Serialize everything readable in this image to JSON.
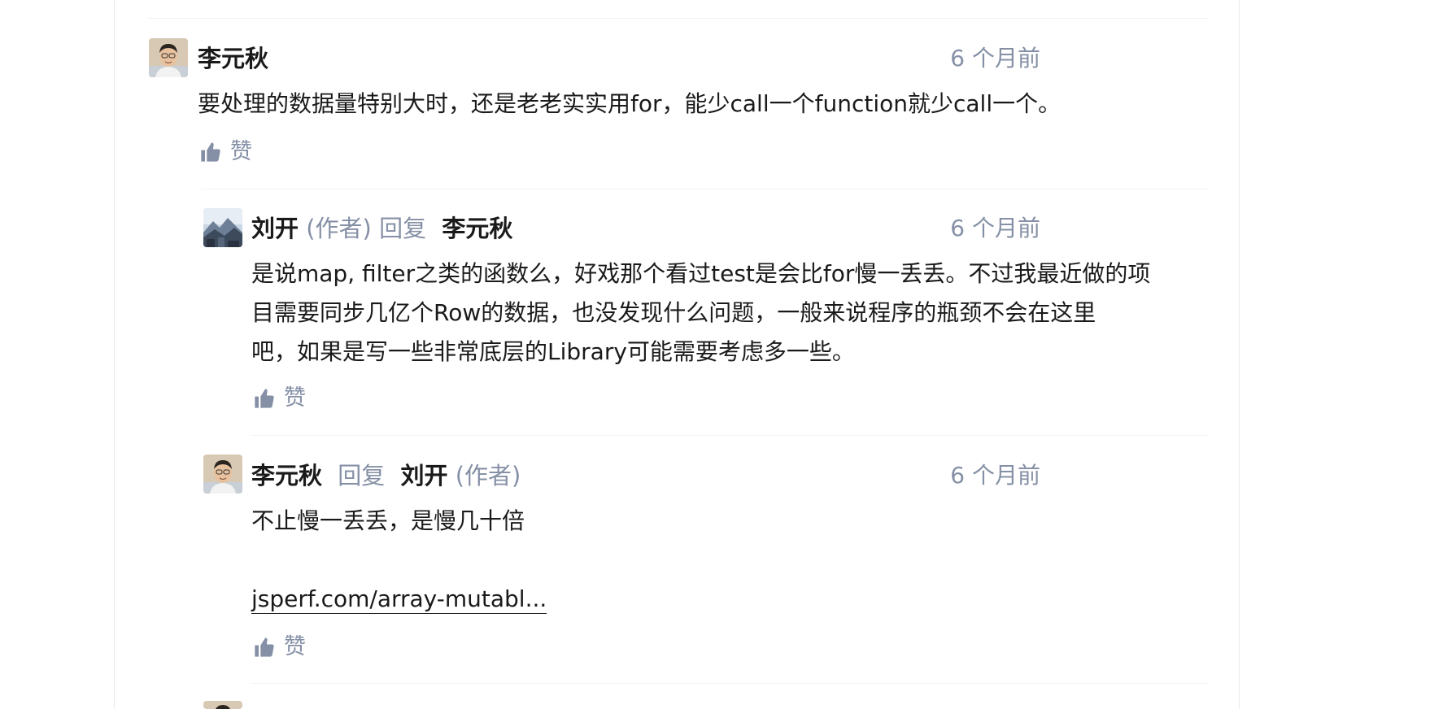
{
  "comments": [
    {
      "author": "李元秋",
      "author_tag": "",
      "reply_label": "",
      "reply_to": "",
      "reply_to_tag": "",
      "time": "6 个月前",
      "content": [
        "要处理的数据量特别大时，还是老老实实用for，能少call一个function就少call一个。"
      ],
      "like_label": "赞",
      "avatar_icon": "person-avatar"
    },
    {
      "author": "刘开",
      "author_tag": "(作者)",
      "reply_label": "回复",
      "reply_to": "李元秋",
      "reply_to_tag": "",
      "time": "6 个月前",
      "content": [
        "是说map, filter之类的函数么，好戏那个看过test是会比for慢一丢丢。不过我最近做的项",
        "目需要同步几亿个Row的数据，也没发现什么问题，一般来说程序的瓶颈不会在这里",
        "吧，如果是写一些非常底层的Library可能需要考虑多一些。"
      ],
      "like_label": "赞",
      "avatar_icon": "landscape-avatar"
    },
    {
      "author": "李元秋",
      "author_tag": "",
      "reply_label": "回复",
      "reply_to": "刘开",
      "reply_to_tag": "(作者)",
      "time": "6 个月前",
      "content": [
        "不止慢一丢丢，是慢几十倍"
      ],
      "link": "jsperf.com/array-mutabl...",
      "like_label": "赞",
      "avatar_icon": "person-avatar"
    }
  ],
  "colors": {
    "text": "#1a1a1a",
    "muted": "#8590a6",
    "divider": "#f0f2f7",
    "card_border": "#ebebeb"
  }
}
